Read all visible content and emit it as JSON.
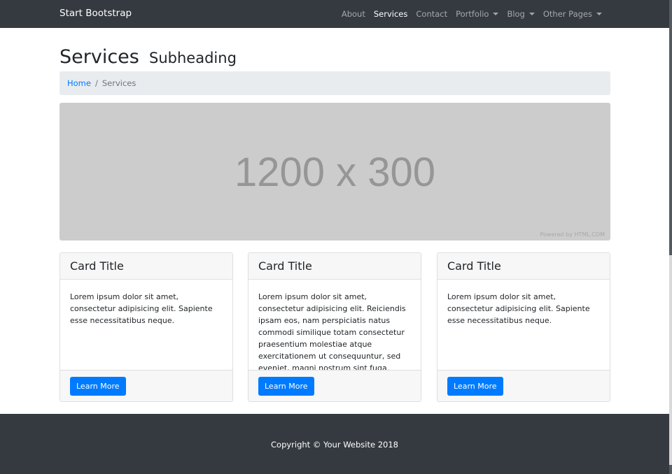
{
  "navbar": {
    "brand": "Start Bootstrap",
    "items": [
      {
        "label": "About",
        "active": false,
        "dropdown": false
      },
      {
        "label": "Services",
        "active": true,
        "dropdown": false
      },
      {
        "label": "Contact",
        "active": false,
        "dropdown": false
      },
      {
        "label": "Portfolio",
        "active": false,
        "dropdown": true
      },
      {
        "label": "Blog",
        "active": false,
        "dropdown": true
      },
      {
        "label": "Other Pages",
        "active": false,
        "dropdown": true
      }
    ]
  },
  "heading": {
    "title": "Services",
    "subtitle": "Subheading"
  },
  "breadcrumb": {
    "home": "Home",
    "separator": "/",
    "current": "Services"
  },
  "hero": {
    "placeholder_text": "1200 x 300",
    "credit": "Powered by HTML.COM"
  },
  "cards": [
    {
      "title": "Card Title",
      "body": "Lorem ipsum dolor sit amet, consectetur adipisicing elit. Sapiente esse necessitatibus neque.",
      "button": "Learn More"
    },
    {
      "title": "Card Title",
      "body": "Lorem ipsum dolor sit amet, consectetur adipisicing elit. Reiciendis ipsam eos, nam perspiciatis natus commodi similique totam consectetur praesentium molestiae atque exercitationem ut consequuntur, sed eveniet, magni nostrum sint fuga.",
      "button": "Learn More"
    },
    {
      "title": "Card Title",
      "body": "Lorem ipsum dolor sit amet, consectetur adipisicing elit. Sapiente esse necessitatibus neque.",
      "button": "Learn More"
    }
  ],
  "footer": {
    "copyright": "Copyright © Your Website 2018"
  },
  "colors": {
    "navbar_bg": "#343a40",
    "primary": "#007bff",
    "breadcrumb_bg": "#e9ecef",
    "placeholder_bg": "#cccccc"
  }
}
